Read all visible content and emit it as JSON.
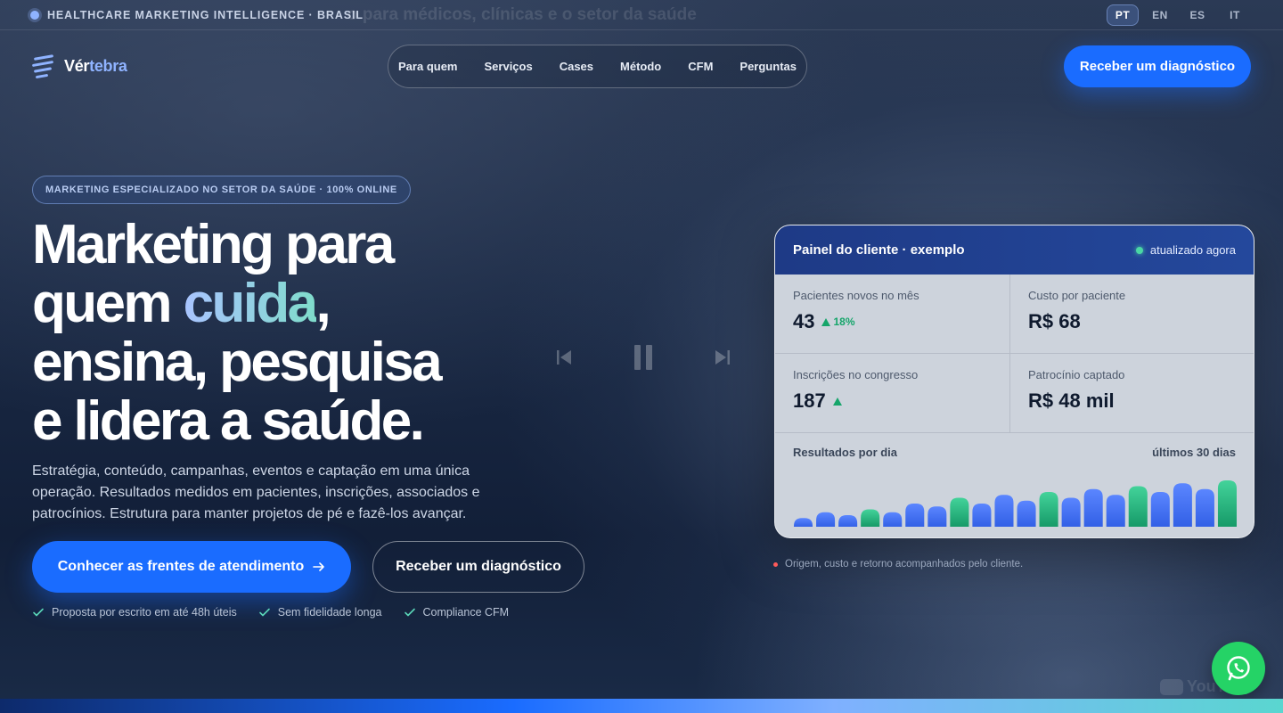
{
  "topbar": {
    "label": "HEALTHCARE MARKETING INTELLIGENCE · BRASIL",
    "ghost_text": "o para médicos, clínicas e o setor da saúde",
    "languages": [
      "PT",
      "EN",
      "ES",
      "IT"
    ],
    "active_language": "PT"
  },
  "brand": {
    "name_part1": "Vér",
    "name_part2": "tebra"
  },
  "nav": {
    "items": [
      "Para quem",
      "Serviços",
      "Cases",
      "Método",
      "CFM",
      "Perguntas"
    ]
  },
  "header_cta": "Receber um diagnóstico",
  "hero": {
    "badge": "MARKETING ESPECIALIZADO NO SETOR DA SAÚDE · 100% ONLINE",
    "headline_1": "Marketing para",
    "headline_2a": "quem ",
    "headline_2_highlight": "cuida",
    "headline_2b": ",",
    "headline_3": "ensina, pesquisa",
    "headline_4": "e lidera a saúde.",
    "subtitle": "Estratégia, conteúdo, campanhas, eventos e captação em uma única operação. Resultados medidos em pacientes, inscrições, associados e patrocínios. Estrutura para manter projetos de pé e fazê-los avançar.",
    "primary_cta": "Conhecer as frentes de atendimento",
    "secondary_cta": "Receber um diagnóstico",
    "checks": [
      "Proposta por escrito em até 48h úteis",
      "Sem fidelidade longa",
      "Compliance CFM"
    ]
  },
  "dashboard": {
    "title": "Painel do cliente · exemplo",
    "status": "atualizado agora",
    "metrics": [
      {
        "label": "Pacientes novos no mês",
        "value": "43",
        "delta": "18%"
      },
      {
        "label": "Custo por paciente",
        "value": "R$ 68",
        "delta": ""
      },
      {
        "label": "Inscrições no congresso",
        "value": "187",
        "delta": ""
      },
      {
        "label": "Patrocínio captado",
        "value": "R$ 48 mil",
        "delta": ""
      }
    ],
    "chart_title": "Resultados por dia",
    "chart_range": "últimos 30 dias",
    "note": "Origem, custo e retorno acompanhados pelo cliente."
  },
  "chart_data": {
    "type": "bar",
    "values": [
      3,
      5,
      4,
      6,
      5,
      8,
      7,
      10,
      8,
      11,
      9,
      12,
      10,
      13,
      11,
      14,
      12,
      15,
      13,
      16
    ],
    "highlight_indices": [
      3,
      7,
      11,
      15,
      19
    ],
    "colors": {
      "base": "#3f6ff5",
      "highlight": "#25b27f"
    }
  },
  "watermark": "YouTube",
  "colors": {
    "accent": "#1a6cff",
    "success": "#25d366"
  }
}
